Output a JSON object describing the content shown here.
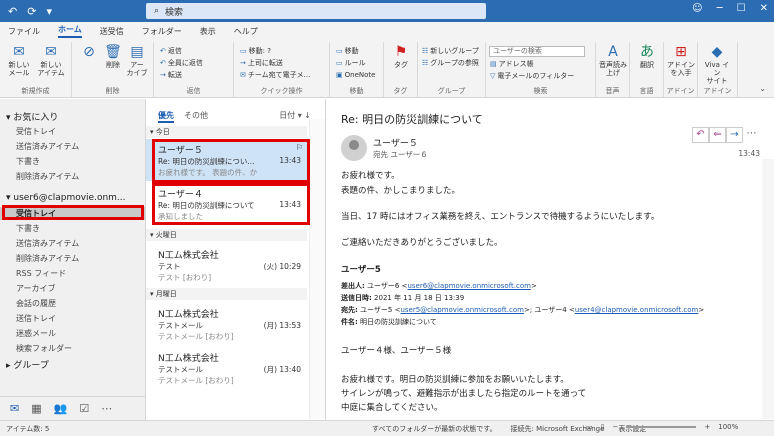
{
  "titlebar": {
    "search_placeholder": "検索",
    "icons": [
      "undo-icon",
      "refresh-icon",
      "dropdown-icon"
    ]
  },
  "tabs": [
    "ファイル",
    "ホーム",
    "送受信",
    "フォルダー",
    "表示",
    "ヘルプ"
  ],
  "ribbon": {
    "new_mail": "新しい\nメール",
    "new_items": "新しい\nアイテム",
    "delete": "削除",
    "archive": "アー\nカイブ",
    "reply": "返信",
    "reply_all": "全員に返信",
    "forward": "転送",
    "move_to": "移動: ?",
    "to_manager": "上司に転送",
    "team_email": "チーム宛て電子メ...",
    "move": "移動",
    "rules": "ルール",
    "onenote": "OneNote",
    "tags": "タグ",
    "unread": "未読/既読",
    "browse_groups": "新しいグループ",
    "group_browse": "グループの参照",
    "search_people": "ユーザーの検索",
    "address_book": "アドレス帳",
    "filter_email": "電子メールのフィルター",
    "read_aloud": "音声読み上げ",
    "translate": "翻訳",
    "all_apps": "アドイン\nを入手",
    "viva": "Viva イン\nサイト",
    "group_labels": [
      "新規作成",
      "削除",
      "返信",
      "クイック操作",
      "移動",
      "タグ",
      "グループ",
      "検索",
      "音声",
      "言語",
      "アドイン",
      "アドイン"
    ]
  },
  "folders": {
    "favorites_header": "お気に入り",
    "favorites": [
      "受信トレイ",
      "送信済みアイテム",
      "下書き",
      "削除済みアイテム"
    ],
    "account": "user6@clapmovie.onm...",
    "account_items": [
      "受信トレイ",
      "下書き",
      "送信済みアイテム",
      "削除済みアイテム",
      "RSS フィード",
      "アーカイブ",
      "会話の履歴",
      "送信トレイ",
      "迷惑メール",
      "検索フォルダー"
    ],
    "groups": "グループ"
  },
  "navbar": [
    "mail-icon",
    "calendar-icon",
    "people-icon",
    "tasks-icon",
    "more-icon"
  ],
  "msglist": {
    "tab_focused": "優先",
    "tab_other": "その他",
    "sort": "日付",
    "groups": [
      "今日",
      "火曜日",
      "月曜日"
    ],
    "messages": [
      {
        "from": "ユーザー５",
        "subject": "Re: 明日の防災訓練につい...",
        "preview": "お疲れ様です。 表題の件、か",
        "time": "13:43"
      },
      {
        "from": "ユーザー４",
        "subject": "Re: 明日の防災訓練について",
        "preview": "承知しました",
        "time": "13:43"
      },
      {
        "from": "N工ム株式会社",
        "subject": "テスト",
        "preview": "テスト [おわり]",
        "time": "(火) 10:29"
      },
      {
        "from": "N工ム株式会社",
        "subject": "テストメール",
        "preview": "テストメール [おわり]",
        "time": "(月) 13:53"
      },
      {
        "from": "N工ム株式会社",
        "subject": "テストメール",
        "preview": "テストメール [おわり]",
        "time": "(月) 13:40"
      }
    ]
  },
  "reading": {
    "subject": "Re: 明日の防災訓練について",
    "sender": "ユーザー５",
    "to": "宛先  ユーザー６",
    "time": "13:43",
    "greeting": "お疲れ様です。",
    "line1": "表題の件、かしこまりました。",
    "line2": "当日、17 時にはオフィス業務を終え、エントランスで待機するようにいたします。",
    "line3": "ご連絡いただきありがとうございました。",
    "signature": "ユーザー5",
    "from_label": "差出人:",
    "from_value": "ユーザー6 <",
    "from_link": "user6@clapmovie.onmicrosoft.com",
    "from_end": ">",
    "sent_label": "送信日時:",
    "sent_value": "2021 年 11 月 18 日 13:39",
    "to_label": "宛先:",
    "to_value": "ユーザー5 <",
    "to_link1": "user5@clapmovie.onmicrosoft.com",
    "to_mid": ">; ユーザー4 <",
    "to_link2": "user4@clapmovie.onmicrosoft.com",
    "to_end": ">",
    "subj_label": "件名:",
    "subj_value": "明日の防災訓練について",
    "q1": "ユーザー４様、ユーザー５様",
    "q2": "お疲れ様です。明日の防災訓練に参加をお願いいたします。",
    "q3": "サイレンが鳴って、避難指示が出ましたら指定のルートを通って",
    "q4": "中庭に集合してください。"
  },
  "statusbar": {
    "items": "アイテム数: 5",
    "filter": "すべてのフォルダーが最新の状態です。",
    "connected": "接続先: Microsoft Exchange",
    "display": "表示設定",
    "zoom": "100%"
  }
}
